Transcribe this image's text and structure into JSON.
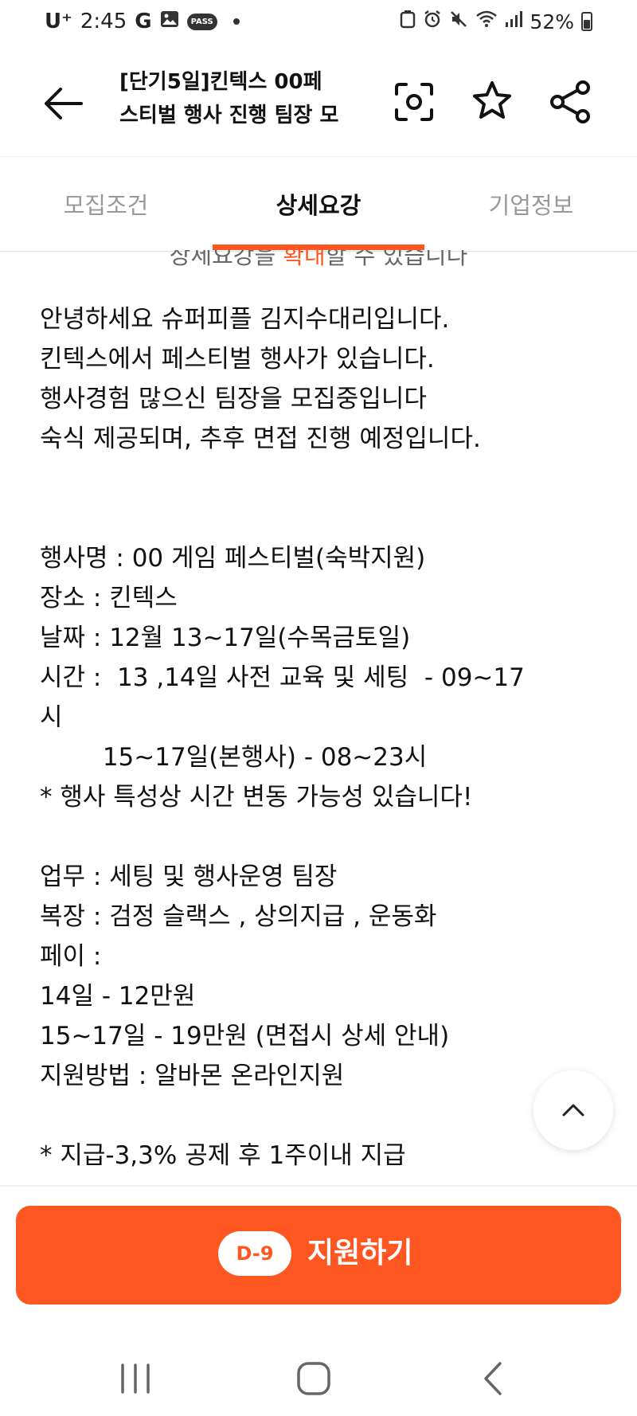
{
  "status_bar": {
    "carrier": "U⁺",
    "time": "2:45",
    "pass_badge": "PASS",
    "battery": "52%"
  },
  "header": {
    "title_line1": "[단기5일]킨텍스 00페",
    "title_line2": "스티벌 행사 진행 팀장 모"
  },
  "tabs": [
    "모집조건",
    "상세요강",
    "기업정보"
  ],
  "partial_line": {
    "before": "상세요강을 ",
    "highlight": "확대",
    "after": "할 수 있습니다"
  },
  "content_lines": [
    "안녕하세요 슈퍼피플 김지수대리입니다.",
    "킨텍스에서 페스티벌 행사가 있습니다.",
    "행사경험 많으신 팀장을 모집중입니다",
    "숙식 제공되며, 추후 면접 진행 예정입니다.",
    "",
    "",
    "행사명 : 00 게임 페스티벌(숙박지원)",
    "장소 : 킨텍스",
    "날짜 : 12월 13~17일(수목금토일)",
    "시간 :  13 ,14일 사전 교육 및 세팅  - 09~17",
    "시",
    "        15~17일(본행사) - 08~23시",
    "* 행사 특성상 시간 변동 가능성 있습니다!",
    "",
    "업무 : 세팅 및 행사운영 팀장",
    "복장 : 검정 슬랙스 , 상의지급 , 운동화",
    "페이 :",
    "14일 - 12만원",
    "15~17일 - 19만원 (면접시 상세 안내)",
    "지원방법 : 알바몬 온라인지원",
    "",
    "* 지급-3,3% 공제 후 1주이내 지급"
  ],
  "apply": {
    "dday": "D-9",
    "label": "지원하기"
  },
  "colors": {
    "accent": "#ff5722",
    "muted_text": "#999999",
    "text": "#111111"
  },
  "icons": [
    "back-arrow-icon",
    "screenshot-scan-icon",
    "star-icon",
    "share-icon",
    "chevron-up-icon",
    "recents-icon",
    "home-icon",
    "back-icon"
  ]
}
